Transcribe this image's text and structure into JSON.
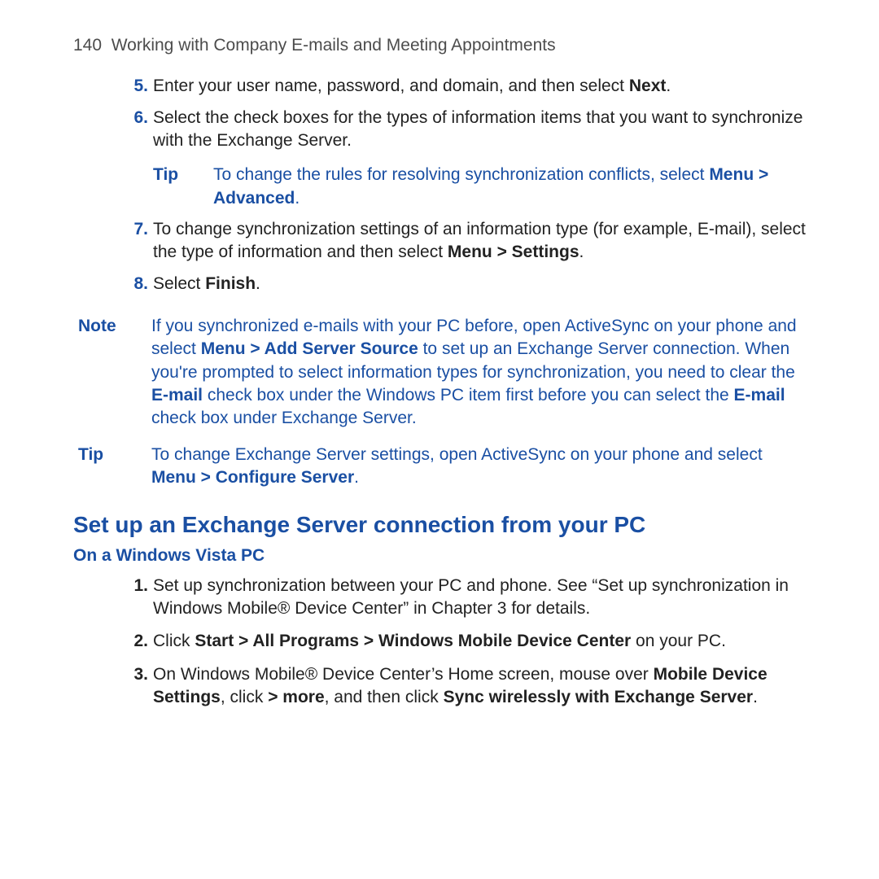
{
  "header": {
    "page_number": "140",
    "title": "Working with Company E-mails and Meeting Appointments"
  },
  "steps": {
    "s5": {
      "text_a": "Enter your user name, password, and domain, and then select ",
      "bold_a": "Next",
      "text_b": "."
    },
    "s6": {
      "text": "Select the check boxes for the types of information items that you want to synchronize with the Exchange Server."
    },
    "s7": {
      "text_a": "To change synchronization settings of an information type (for example, E-mail), select the type of information and then select ",
      "bold_a": "Menu > Settings",
      "text_b": "."
    },
    "s8": {
      "text_a": "Select ",
      "bold_a": "Finish",
      "text_b": "."
    }
  },
  "tip1": {
    "label": "Tip",
    "text_a": "To change the rules for resolving synchronization conflicts, select ",
    "bold_a": "Menu > Advanced",
    "text_b": "."
  },
  "note1": {
    "label": "Note",
    "t1": "If you synchronized e-mails with your PC before, open ActiveSync on your phone and select ",
    "b1": "Menu > Add Server Source",
    "t2": " to set up an Exchange Server connection. When you're prompted to select information types for synchronization, you need to clear the ",
    "b2": "E-mail",
    "t3": " check box under the Windows PC item first before you can select the ",
    "b3": "E-mail",
    "t4": " check box under Exchange Server."
  },
  "tip2": {
    "label": "Tip",
    "text_a": "To change Exchange Server settings, open ActiveSync on your phone and select ",
    "bold_a": "Menu > Configure Server",
    "text_b": "."
  },
  "section": {
    "heading": "Set up an Exchange Server connection from your PC",
    "subheading": "On a Windows Vista PC"
  },
  "bsteps": {
    "b1": {
      "text": "Set up synchronization between your PC and phone. See “Set up synchronization in Windows Mobile® Device Center” in Chapter 3 for details."
    },
    "b2": {
      "t1": "Click ",
      "b1": "Start > All Programs > Windows Mobile Device Center",
      "t2": " on your PC."
    },
    "b3": {
      "t1": "On Windows Mobile® Device Center’s Home screen, mouse over ",
      "b1": "Mobile Device Settings",
      "t2": ", click ",
      "b2": "> more",
      "t3": ", and then click ",
      "b3": "Sync wirelessly with Exchange Server",
      "t4": "."
    }
  }
}
